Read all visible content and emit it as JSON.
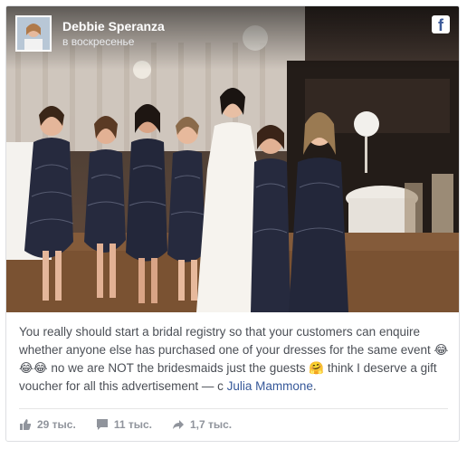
{
  "post": {
    "author": "Debbie Speranza",
    "timestamp": "в воскресенье",
    "network_icon": "facebook-icon",
    "text_part1": "You really should start a bridal registry so that your customers can enquire whether anyone else has purchased one of your dresses for the same event",
    "emoji1": "😂😂😂",
    "text_part2": "no we are NOT the bridesmaids just the guests",
    "emoji2": "🤗",
    "text_part3": "think I deserve a gift voucher for all this advertisement — с",
    "tagged_user": "Julia Mammone",
    "text_end": "."
  },
  "stats": {
    "likes": "29 тыс.",
    "comments": "11 тыс.",
    "shares": "1,7 тыс."
  },
  "colors": {
    "link": "#365899",
    "text": "#4b4f56",
    "meta": "#90949c",
    "facebook_blue": "#3b5998"
  }
}
